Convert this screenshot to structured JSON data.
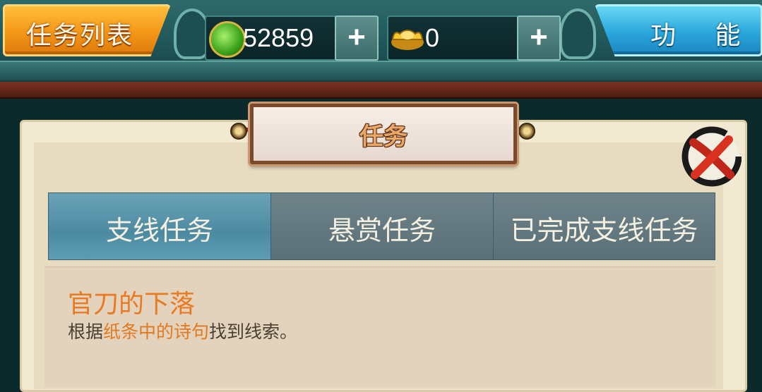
{
  "topbar": {
    "quest_list_label": "任务列表",
    "function_label": "功  能",
    "jade_amount": "52859",
    "ingot_amount": "0",
    "plus_label": "+"
  },
  "dialog": {
    "title": "任务",
    "tabs": [
      {
        "label": "支线任务",
        "active": true
      },
      {
        "label": "悬赏任务",
        "active": false
      },
      {
        "label": "已完成支线任务",
        "active": false
      }
    ],
    "quest": {
      "title": "官刀的下落",
      "desc_prefix": "根据",
      "desc_highlight": "纸条中的诗句",
      "desc_suffix": "找到线索。"
    }
  },
  "colors": {
    "accent_orange": "#f39718",
    "accent_blue": "#2aa7dc",
    "tab_active": "#5d9db3",
    "quest_highlight": "#e87a22"
  },
  "icons": [
    "jade-currency-icon",
    "gold-ingot-icon",
    "close-icon"
  ]
}
